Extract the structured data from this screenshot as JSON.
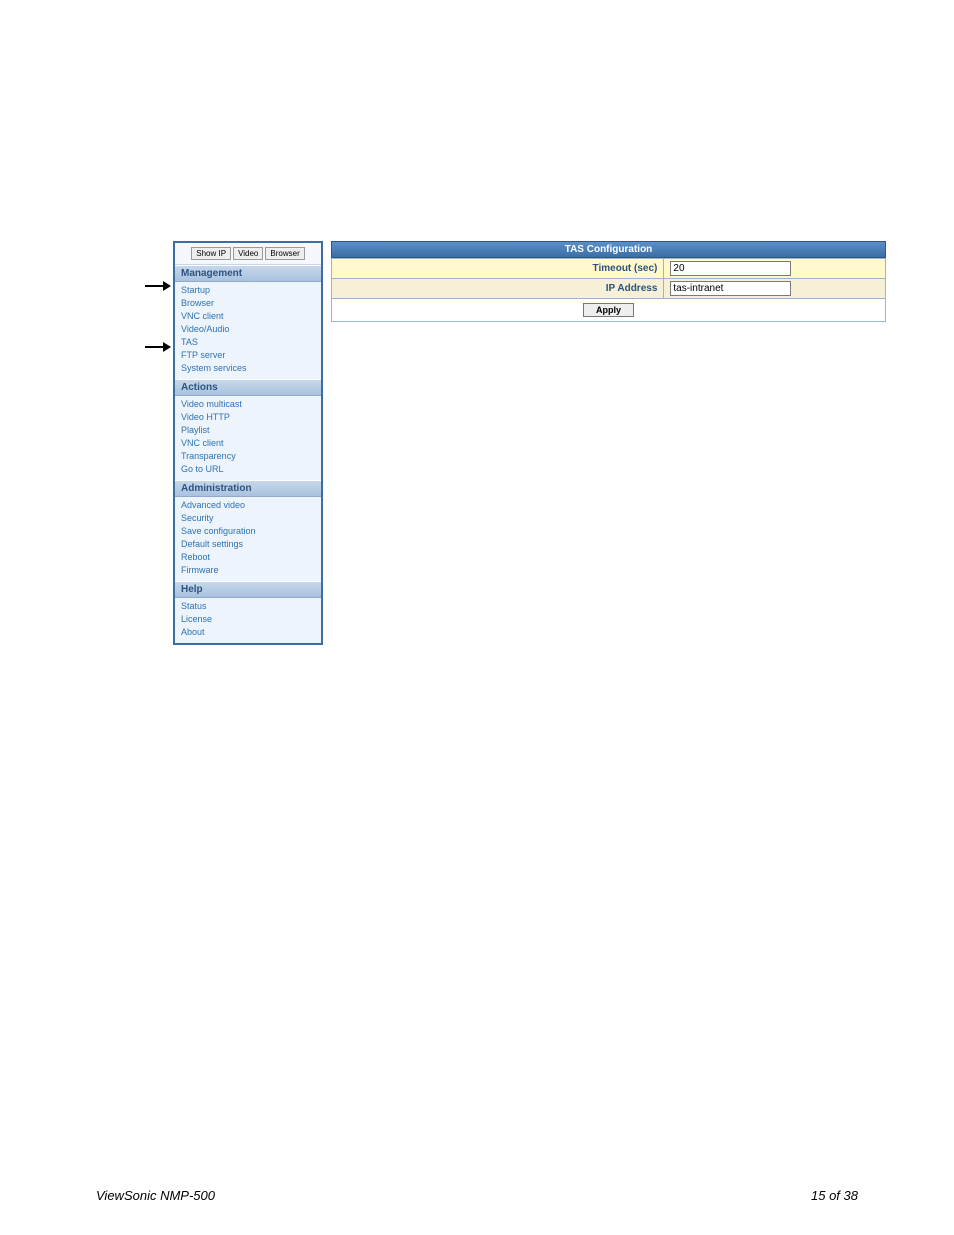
{
  "sidebar": {
    "top_buttons": {
      "show_ip": "Show IP",
      "video": "Video",
      "browser": "Browser"
    },
    "sections": {
      "management": {
        "title": "Management",
        "items": [
          "Startup",
          "Browser",
          "VNC client",
          "Video/Audio",
          "TAS",
          "FTP server",
          "System services"
        ]
      },
      "actions": {
        "title": "Actions",
        "items": [
          "Video multicast",
          "Video HTTP",
          "Playlist",
          "VNC client",
          "Transparency",
          "Go to URL"
        ]
      },
      "administration": {
        "title": "Administration",
        "items": [
          "Advanced video",
          "Security",
          "Save configuration",
          "Default settings",
          "Reboot",
          "Firmware"
        ]
      },
      "help": {
        "title": "Help",
        "items": [
          "Status",
          "License",
          "About"
        ]
      }
    }
  },
  "main": {
    "panel_title": "TAS Configuration",
    "rows": {
      "timeout": {
        "label": "Timeout (sec)",
        "value": "20"
      },
      "ip": {
        "label": "IP Address",
        "value": "tas-intranet"
      }
    },
    "apply_label": "Apply"
  },
  "footer": {
    "left": "ViewSonic NMP-500",
    "right": "15 of  38"
  }
}
